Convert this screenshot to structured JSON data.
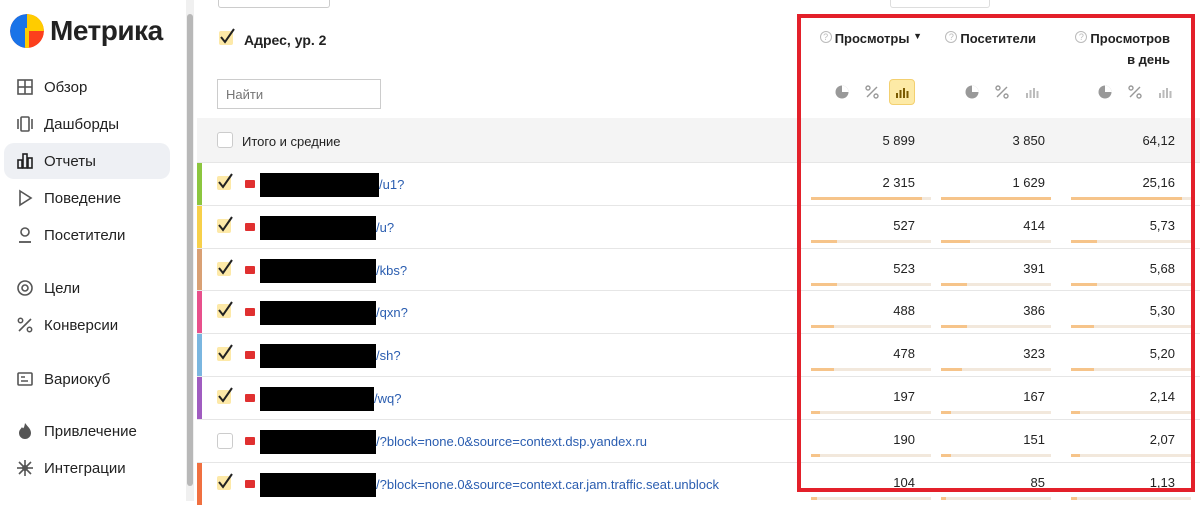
{
  "app": {
    "title": "Метрика"
  },
  "sidebar": {
    "items": [
      {
        "label": "Обзор",
        "icon": "grid-icon"
      },
      {
        "label": "Дашборды",
        "icon": "dashboards-icon"
      },
      {
        "label": "Отчеты",
        "icon": "bar-chart-icon",
        "active": true
      },
      {
        "label": "Поведение",
        "icon": "play-icon"
      },
      {
        "label": "Посетители",
        "icon": "person-icon"
      },
      {
        "label": "Цели",
        "icon": "target-icon"
      },
      {
        "label": "Конверсии",
        "icon": "percent-icon"
      },
      {
        "label": "Вариокуб",
        "icon": "cube-icon"
      },
      {
        "label": "Привлечение",
        "icon": "flame-icon"
      },
      {
        "label": "Интеграции",
        "icon": "integrations-icon"
      }
    ]
  },
  "table": {
    "dimension_title": "Адрес, ур. 2",
    "search_placeholder": "Найти",
    "columns": [
      {
        "label": "Просмотры",
        "sort": "▼"
      },
      {
        "label": "Посетители"
      },
      {
        "label": "Просмотров",
        "label2": "в день"
      }
    ],
    "total": {
      "label": "Итого и средние",
      "values": [
        "5 899",
        "3 850",
        "64,12"
      ]
    },
    "rows": [
      {
        "url": "/u1?",
        "values": [
          "2 315",
          "1 629",
          "25,16"
        ],
        "fractions": [
          0.39,
          0.42,
          0.39
        ],
        "checked": true,
        "color": "#8cc63f"
      },
      {
        "url": "/u?",
        "values": [
          "527",
          "414",
          "5,73"
        ],
        "fractions": [
          0.09,
          0.11,
          0.09
        ],
        "checked": true,
        "color": "#f7d04a"
      },
      {
        "url": "/kbs?",
        "values": [
          "523",
          "391",
          "5,68"
        ],
        "fractions": [
          0.09,
          0.1,
          0.09
        ],
        "checked": true,
        "color": "#d9a074"
      },
      {
        "url": "/qxn?",
        "values": [
          "488",
          "386",
          "5,30"
        ],
        "fractions": [
          0.08,
          0.1,
          0.08
        ],
        "checked": true,
        "color": "#e8508c"
      },
      {
        "url": "/sh?",
        "values": [
          "478",
          "323",
          "5,20"
        ],
        "fractions": [
          0.08,
          0.08,
          0.08
        ],
        "checked": true,
        "color": "#7ab6e0"
      },
      {
        "url": "/wq?",
        "values": [
          "197",
          "167",
          "2,14"
        ],
        "fractions": [
          0.03,
          0.04,
          0.03
        ],
        "checked": true,
        "color": "#a05cc0"
      },
      {
        "url": "/?block=none.0&source=context.dsp.yandex.ru",
        "values": [
          "190",
          "151",
          "2,07"
        ],
        "fractions": [
          0.03,
          0.04,
          0.03
        ],
        "checked": false,
        "color": ""
      },
      {
        "url": "/?block=none.0&source=context.car.jam.traffic.seat.unblock",
        "values": [
          "104",
          "85",
          "1,13"
        ],
        "fractions": [
          0.02,
          0.02,
          0.02
        ],
        "checked": true,
        "color": "#f07040"
      }
    ]
  },
  "colors": {
    "accent": "#e3202a",
    "bar": "#f6c48a",
    "link": "#2a5db0"
  }
}
